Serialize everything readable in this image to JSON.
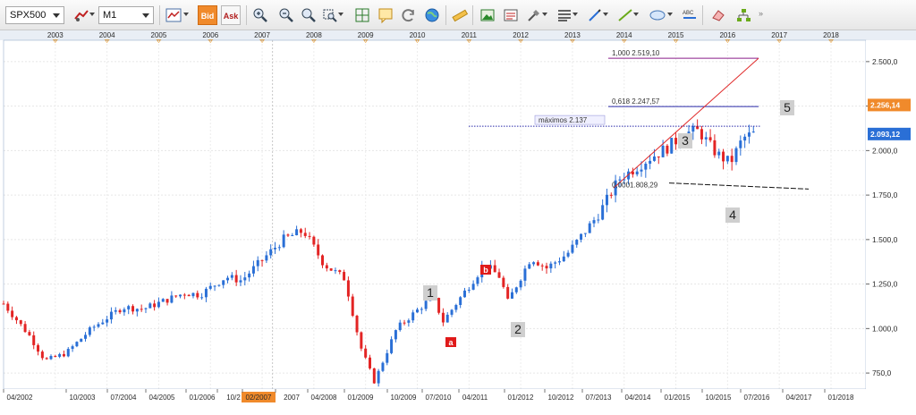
{
  "toolbar": {
    "symbol": "SPX500",
    "timeframe": "M1",
    "bid_label": "Bid",
    "ask_label": "Ask"
  },
  "colors": {
    "bull": "#2a6fd6",
    "bear": "#e32424",
    "accent": "#f08a2b",
    "fib_upper": "#8a1e8a",
    "fib_mid": "#2a2aaa",
    "trend": "#e02a2a"
  },
  "chart_data": {
    "type": "candlestick",
    "symbol": "SPX500",
    "timeframe": "M1",
    "ylim": [
      660,
      2620
    ],
    "xlim": [
      "2002-01",
      "2018-12"
    ],
    "year_labels": [
      "2003",
      "2004",
      "2005",
      "2006",
      "2007",
      "2008",
      "2009",
      "2010",
      "2011",
      "2012",
      "2013",
      "2014",
      "2015",
      "2016",
      "2017",
      "2018"
    ],
    "date_labels": [
      "04/2002",
      "10/2003",
      "07/2004",
      "04/2005",
      "01/2006",
      "10/2",
      "02/2007",
      "2007",
      "04/2008",
      "01/2009",
      "10/2009",
      "07/2010",
      "04/2011",
      "01/2012",
      "10/2012",
      "07/2013",
      "04/2014",
      "01/2015",
      "10/2015",
      "07/2016",
      "04/2017",
      "01/2018"
    ],
    "price_ticks": [
      "2.500,0",
      "2.250,0",
      "2.000,0",
      "1.750,0",
      "1.500,0",
      "1.250,0",
      "1.000,0",
      "750,0"
    ],
    "price_tick_values": [
      2500,
      2250,
      2000,
      1750,
      1500,
      1250,
      1000,
      750
    ],
    "highlighted_date": "02/2007",
    "price_badges": [
      {
        "label": "2.256,14",
        "value": 2256.14,
        "color": "#f08a2b"
      },
      {
        "label": "2.093,12",
        "value": 2093.12,
        "color": "#2a6fd6"
      }
    ],
    "annotations": [
      {
        "text": "1,000 2.519,10"
      },
      {
        "text": "0,618 2.247,57"
      },
      {
        "text": "máximos 2.137"
      },
      {
        "text": "0,0001.808,29"
      }
    ],
    "wave_labels": [
      "1",
      "2",
      "3",
      "4",
      "5"
    ],
    "tag_labels": [
      "a",
      "b"
    ],
    "anchors": [
      {
        "t": 2002.0,
        "v": 1140
      },
      {
        "t": 2002.5,
        "v": 960
      },
      {
        "t": 2002.8,
        "v": 820
      },
      {
        "t": 2003.2,
        "v": 860
      },
      {
        "t": 2003.7,
        "v": 1000
      },
      {
        "t": 2004.3,
        "v": 1120
      },
      {
        "t": 2004.7,
        "v": 1110
      },
      {
        "t": 2005.5,
        "v": 1200
      },
      {
        "t": 2005.8,
        "v": 1190
      },
      {
        "t": 2006.3,
        "v": 1290
      },
      {
        "t": 2006.6,
        "v": 1270
      },
      {
        "t": 2007.4,
        "v": 1500
      },
      {
        "t": 2007.8,
        "v": 1550
      },
      {
        "t": 2008.2,
        "v": 1360
      },
      {
        "t": 2008.6,
        "v": 1280
      },
      {
        "t": 2008.9,
        "v": 900
      },
      {
        "t": 2009.17,
        "v": 700
      },
      {
        "t": 2009.6,
        "v": 1000
      },
      {
        "t": 2010.3,
        "v": 1180
      },
      {
        "t": 2010.5,
        "v": 1040
      },
      {
        "t": 2010.75,
        "v": 1140
      },
      {
        "t": 2011.3,
        "v": 1360
      },
      {
        "t": 2011.6,
        "v": 1290
      },
      {
        "t": 2011.75,
        "v": 1150
      },
      {
        "t": 2012.2,
        "v": 1400
      },
      {
        "t": 2012.5,
        "v": 1340
      },
      {
        "t": 2012.9,
        "v": 1420
      },
      {
        "t": 2013.5,
        "v": 1640
      },
      {
        "t": 2013.9,
        "v": 1840
      },
      {
        "t": 2014.5,
        "v": 1960
      },
      {
        "t": 2014.8,
        "v": 2010
      },
      {
        "t": 2015.2,
        "v": 2100
      },
      {
        "t": 2015.45,
        "v": 2110
      },
      {
        "t": 2015.65,
        "v": 2030
      },
      {
        "t": 2015.8,
        "v": 1980
      },
      {
        "t": 2016.05,
        "v": 1930
      },
      {
        "t": 2016.3,
        "v": 2070
      },
      {
        "t": 2016.5,
        "v": 2093
      }
    ]
  }
}
